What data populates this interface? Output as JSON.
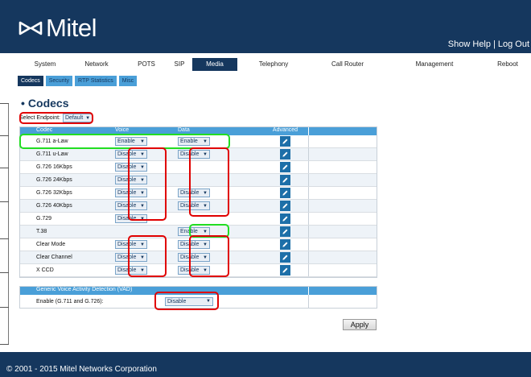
{
  "header": {
    "brand": "Mitel",
    "show_help": "Show Help",
    "separator": "|",
    "log_out": "Log Out"
  },
  "main_nav": [
    {
      "label": "System",
      "active": false
    },
    {
      "label": "Network",
      "active": false
    },
    {
      "label": "POTS",
      "active": false
    },
    {
      "label": "SIP",
      "active": false
    },
    {
      "label": "Media",
      "active": true
    },
    {
      "label": "Telephony",
      "active": false
    },
    {
      "label": "Call Router",
      "active": false
    },
    {
      "label": "Management",
      "active": false
    },
    {
      "label": "Reboot",
      "active": false
    }
  ],
  "sub_nav": [
    {
      "label": "Codecs",
      "active": true
    },
    {
      "label": "Security",
      "active": false
    },
    {
      "label": "RTP Statistics",
      "active": false
    },
    {
      "label": "Misc",
      "active": false
    }
  ],
  "page": {
    "title": "Codecs",
    "endpoint_label": "Select Endpoint:",
    "endpoint_value": "Default"
  },
  "codec_table": {
    "columns": [
      "Codec",
      "Voice",
      "Data",
      "Advanced"
    ],
    "rows": [
      {
        "codec": "G.711 a-Law",
        "voice": "Enable",
        "data": "Enable"
      },
      {
        "codec": "G.711 u-Law",
        "voice": "Disable",
        "data": "Disable"
      },
      {
        "codec": "G.726 16Kbps",
        "voice": "Disable",
        "data": ""
      },
      {
        "codec": "G.726 24Kbps",
        "voice": "Disable",
        "data": ""
      },
      {
        "codec": "G.726 32Kbps",
        "voice": "Disable",
        "data": "Disable"
      },
      {
        "codec": "G.726 40Kbps",
        "voice": "Disable",
        "data": "Disable"
      },
      {
        "codec": "G.729",
        "voice": "Disable",
        "data": ""
      },
      {
        "codec": "T.38",
        "voice": "",
        "data": "Enable"
      },
      {
        "codec": "Clear Mode",
        "voice": "Disable",
        "data": "Disable"
      },
      {
        "codec": "Clear Channel",
        "voice": "Disable",
        "data": "Disable"
      },
      {
        "codec": "X CCD",
        "voice": "Disable",
        "data": "Disable"
      }
    ]
  },
  "vad": {
    "header": "Generic Voice Activity Detection (VAD)",
    "label": "Enable (G.711 and G.726):",
    "value": "Disable"
  },
  "apply_label": "Apply",
  "footer": "© 2001 - 2015 Mitel Networks Corporation",
  "colors": {
    "header_bg": "#15375e",
    "tab_bg": "#4a9fd8",
    "highlight_red": "#e00000",
    "highlight_green": "#22dd22"
  }
}
